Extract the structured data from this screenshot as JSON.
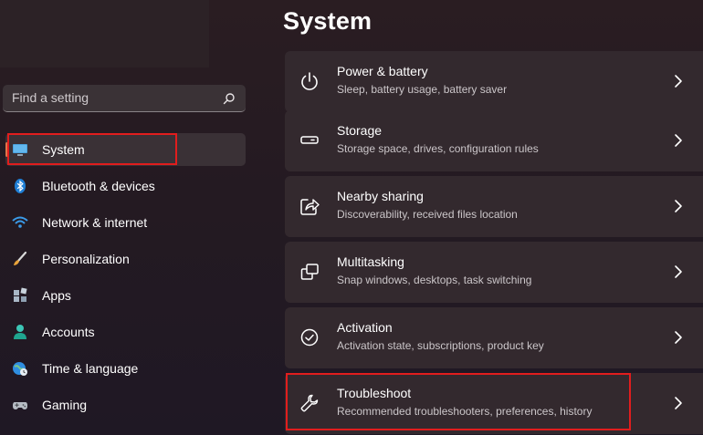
{
  "search": {
    "placeholder": "Find a setting",
    "icon": "search-icon"
  },
  "sidebar": {
    "items": [
      {
        "label": "System",
        "icon": "monitor-icon",
        "selected": true
      },
      {
        "label": "Bluetooth & devices",
        "icon": "bluetooth-icon"
      },
      {
        "label": "Network & internet",
        "icon": "wifi-icon"
      },
      {
        "label": "Personalization",
        "icon": "brush-icon"
      },
      {
        "label": "Apps",
        "icon": "apps-icon"
      },
      {
        "label": "Accounts",
        "icon": "person-icon"
      },
      {
        "label": "Time & language",
        "icon": "globe-clock-icon"
      },
      {
        "label": "Gaming",
        "icon": "gamepad-icon"
      }
    ]
  },
  "main": {
    "title": "System",
    "cards": [
      {
        "title": "Power & battery",
        "subtitle": "Sleep, battery usage, battery saver",
        "icon": "power-icon"
      },
      {
        "title": "Storage",
        "subtitle": "Storage space, drives, configuration rules",
        "icon": "storage-drive-icon"
      },
      {
        "title": "Nearby sharing",
        "subtitle": "Discoverability, received files location",
        "icon": "share-icon"
      },
      {
        "title": "Multitasking",
        "subtitle": "Snap windows, desktops, task switching",
        "icon": "multitasking-icon"
      },
      {
        "title": "Activation",
        "subtitle": "Activation state, subscriptions, product key",
        "icon": "checkmark-circle-icon"
      },
      {
        "title": "Troubleshoot",
        "subtitle": "Recommended troubleshooters, preferences, history",
        "icon": "wrench-icon"
      }
    ]
  },
  "colors": {
    "accent": "#e0764b",
    "highlight_box": "#e11d1d",
    "card_bg": "#33292e"
  }
}
